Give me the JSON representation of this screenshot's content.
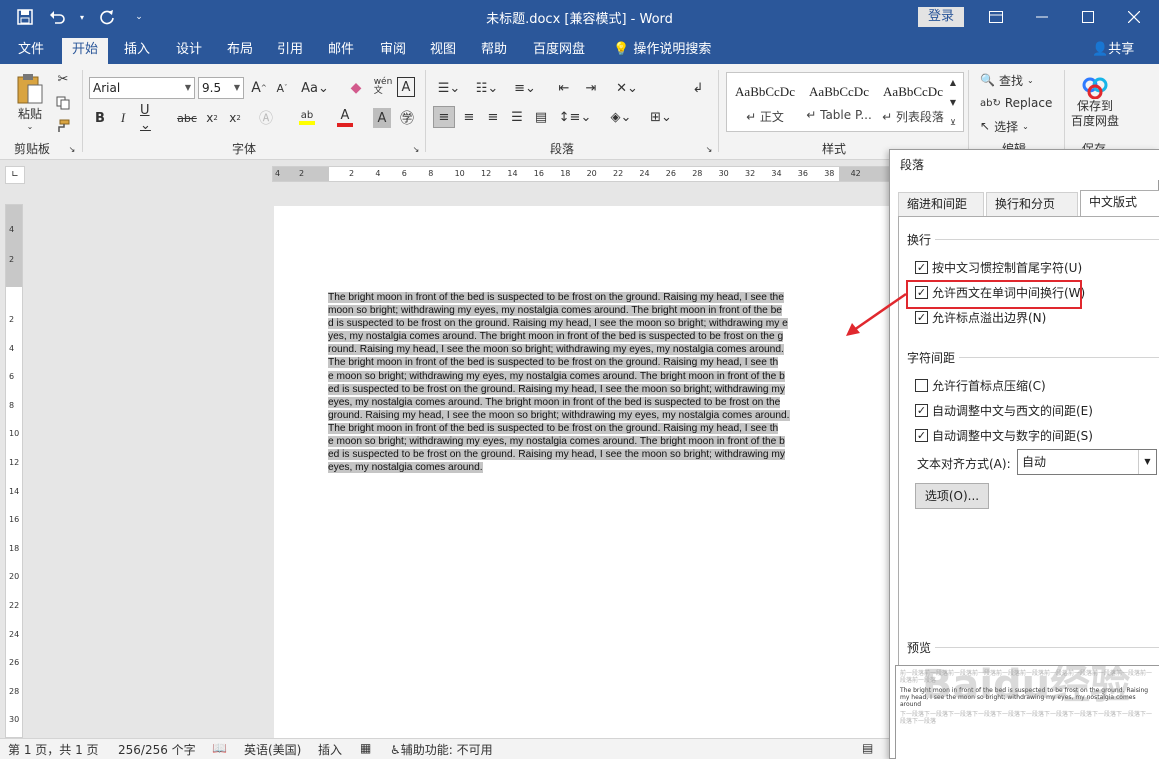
{
  "window": {
    "title": "未标题.docx [兼容模式] - Word",
    "login": "登录"
  },
  "menu_tabs": [
    "文件",
    "开始",
    "插入",
    "设计",
    "布局",
    "引用",
    "邮件",
    "审阅",
    "视图",
    "帮助",
    "百度网盘",
    "操作说明搜索"
  ],
  "share": "共享",
  "ribbon": {
    "clipboard": {
      "paste": "粘贴",
      "label": "剪贴板"
    },
    "font": {
      "name": "Arial",
      "size": "9.5",
      "label": "字体"
    },
    "paragraph": {
      "label": "段落"
    },
    "styles": {
      "label": "样式",
      "items": [
        {
          "preview": "AaBbCcDc",
          "name": "↵ 正文"
        },
        {
          "preview": "AaBbCcDc",
          "name": "↵ Table P..."
        },
        {
          "preview": "AaBbCcDc",
          "name": "↵ 列表段落"
        }
      ]
    },
    "editing": {
      "find": "查找",
      "replace": "Replace",
      "select": "选择",
      "label": "编辑"
    },
    "save_cloud": {
      "line1": "保存到",
      "line2": "百度网盘",
      "label": "保存"
    }
  },
  "ruler": {
    "h_ticks": [
      "4",
      "2",
      "2",
      "4",
      "6",
      "8",
      "10",
      "12",
      "14",
      "16",
      "18",
      "20",
      "22",
      "24",
      "26",
      "28",
      "30",
      "32",
      "34",
      "36",
      "38",
      "42"
    ],
    "v_ticks": [
      "4",
      "2",
      "2",
      "4",
      "6",
      "8",
      "10",
      "12",
      "14",
      "16",
      "18",
      "20",
      "22",
      "24",
      "26",
      "28",
      "30"
    ]
  },
  "document": {
    "lines": [
      "The bright moon in front of the bed is suspected to be frost on the ground. Raising my head, I see the",
      "moon so bright; withdrawing my eyes, my nostalgia comes around.  The bright moon in front of the be",
      "d is suspected to be frost on the ground. Raising my head, I see the moon so bright; withdrawing my e",
      "yes, my nostalgia comes around.  The bright moon in front of the bed is suspected to be frost on the g",
      "round. Raising my head, I see the moon so bright; withdrawing my eyes, my nostalgia comes around.",
      "  The bright moon in front of the bed is suspected to be frost on the ground. Raising my head, I see th",
      "e moon so bright; withdrawing my eyes, my nostalgia comes around.  The bright moon in front of the b",
      "ed is suspected to be frost on the ground. Raising my head, I see the moon so bright; withdrawing my",
      "eyes, my nostalgia comes around.  The bright moon in front of the bed is suspected to be frost on the",
      "ground. Raising my head, I see the moon so bright; withdrawing my eyes, my nostalgia comes around.",
      "  The bright moon in front of the bed is suspected to be frost on the ground. Raising my head, I see th",
      "e moon so bright; withdrawing my eyes, my nostalgia comes around.  The bright moon in front of the b",
      "ed is suspected to be frost on the ground. Raising my head, I see the moon so bright; withdrawing my",
      "eyes, my nostalgia comes around."
    ]
  },
  "status": {
    "page": "第 1 页，共 1 页",
    "words": "256/256 个字",
    "language": "英语(美国)",
    "mode": "插入",
    "accessibility": "辅助功能: 不可用"
  },
  "dialog": {
    "title": "段落",
    "tabs": [
      "缩进和间距(I)",
      "换行和分页(P)",
      "中文版式(H)"
    ],
    "active_tab": 2,
    "line_break": {
      "heading": "换行",
      "options": [
        {
          "label": "按中文习惯控制首尾字符(U)",
          "checked": true
        },
        {
          "label": "允许西文在单词中间换行(W)",
          "checked": true
        },
        {
          "label": "允许标点溢出边界(N)",
          "checked": true
        }
      ]
    },
    "char_spacing": {
      "heading": "字符间距",
      "options": [
        {
          "label": "允许行首标点压缩(C)",
          "checked": false
        },
        {
          "label": "自动调整中文与西文的间距(E)",
          "checked": true
        },
        {
          "label": "自动调整中文与数字的间距(S)",
          "checked": true
        }
      ],
      "alignment_label": "文本对齐方式(A):",
      "alignment_value": "自动",
      "options_button": "选项(O)..."
    },
    "preview": {
      "heading": "预览",
      "before_text": "前一段落前一段落前一段落前一段落前一段落前一段落前一段落前一段落前一段落前一段落前一段落前一段落",
      "sample_text": "The bright moon in front of the bed is suspected to be frost on the ground. Raising my head, I see the moon so bright; withdrawing my eyes, my nostalgia comes around",
      "after_text": "下一段落下一段落下一段落下一段落下一段落下一段落下一段落下一段落下一段落下一段落下一段落下一段落"
    },
    "watermark": "Baidu经验"
  },
  "colors": {
    "title_blue": "#2b579a",
    "highlight_red": "#e0282e",
    "selection_gray": "#c5c5c5"
  }
}
